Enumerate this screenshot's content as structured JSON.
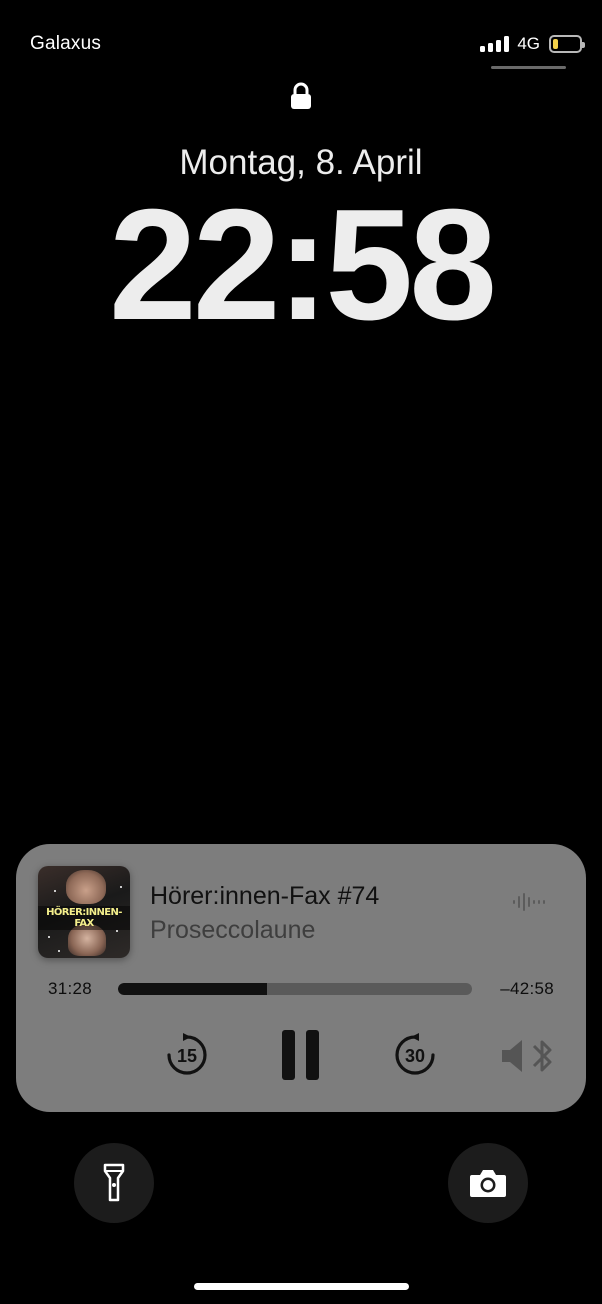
{
  "status_bar": {
    "carrier": "Galaxus",
    "network": "4G",
    "battery_level": 0.2,
    "battery_color": "#f3d14a"
  },
  "lock_screen": {
    "date": "Montag, 8. April",
    "time": "22:58"
  },
  "now_playing": {
    "episode_title": "Hörer:innen-Fax #74",
    "podcast": "Proseccolaune",
    "artwork_text": "HÖRER:INNEN-FAX",
    "elapsed": "31:28",
    "remaining": "–42:58",
    "progress": 0.42,
    "skip_back_seconds": "15",
    "skip_forward_seconds": "30",
    "card_color": "#7d7d7d"
  },
  "quick_actions": {
    "left": "flashlight-icon",
    "right": "camera-icon"
  }
}
